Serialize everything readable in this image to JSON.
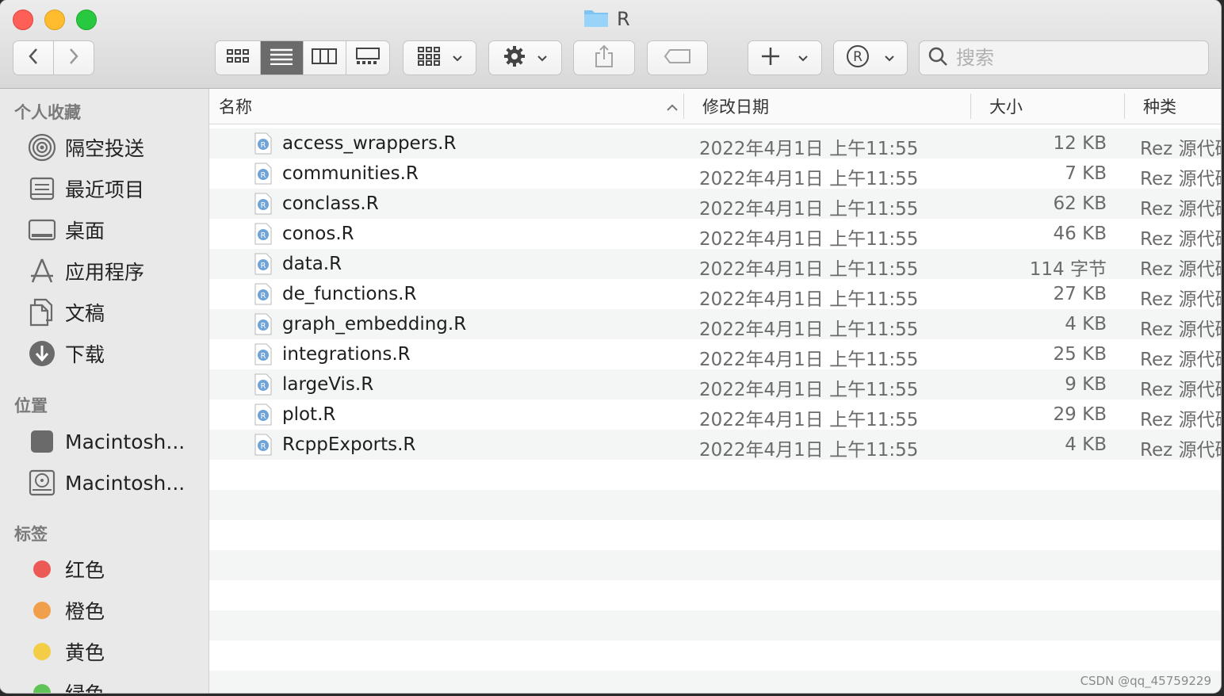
{
  "window": {
    "title": "R"
  },
  "toolbar": {
    "back_icon": "chevron-left-icon",
    "forward_icon": "chevron-right-icon",
    "view_modes": [
      "icon-view",
      "list-view",
      "column-view",
      "gallery-view"
    ],
    "active_view": "list-view",
    "search_placeholder": "搜索"
  },
  "sidebar": {
    "favorites_heading": "个人收藏",
    "favorites": [
      {
        "label": "隔空投送",
        "icon": "airdrop-icon"
      },
      {
        "label": "最近项目",
        "icon": "recents-icon"
      },
      {
        "label": "桌面",
        "icon": "desktop-icon"
      },
      {
        "label": "应用程序",
        "icon": "applications-icon"
      },
      {
        "label": "文稿",
        "icon": "documents-icon"
      },
      {
        "label": "下载",
        "icon": "downloads-icon"
      }
    ],
    "locations_heading": "位置",
    "locations": [
      {
        "label": "Macintosh...",
        "icon": "disk-icon"
      },
      {
        "label": "Macintosh...",
        "icon": "external-disk-icon"
      }
    ],
    "tags_heading": "标签",
    "tags": [
      {
        "label": "红色",
        "color": "#ec5a55"
      },
      {
        "label": "橙色",
        "color": "#f0a04b"
      },
      {
        "label": "黄色",
        "color": "#f4cd47"
      },
      {
        "label": "绿色",
        "color": "#5fc455"
      }
    ]
  },
  "columns": {
    "name": "名称",
    "date": "修改日期",
    "size": "大小",
    "kind": "种类"
  },
  "files": [
    {
      "name": "access_wrappers.R",
      "date": "2022年4月1日 上午11:55",
      "size": "12 KB",
      "kind": "Rez 源代码"
    },
    {
      "name": "communities.R",
      "date": "2022年4月1日 上午11:55",
      "size": "7 KB",
      "kind": "Rez 源代码"
    },
    {
      "name": "conclass.R",
      "date": "2022年4月1日 上午11:55",
      "size": "62 KB",
      "kind": "Rez 源代码"
    },
    {
      "name": "conos.R",
      "date": "2022年4月1日 上午11:55",
      "size": "46 KB",
      "kind": "Rez 源代码"
    },
    {
      "name": "data.R",
      "date": "2022年4月1日 上午11:55",
      "size": "114 字节",
      "kind": "Rez 源代码"
    },
    {
      "name": "de_functions.R",
      "date": "2022年4月1日 上午11:55",
      "size": "27 KB",
      "kind": "Rez 源代码"
    },
    {
      "name": "graph_embedding.R",
      "date": "2022年4月1日 上午11:55",
      "size": "4 KB",
      "kind": "Rez 源代码"
    },
    {
      "name": "integrations.R",
      "date": "2022年4月1日 上午11:55",
      "size": "25 KB",
      "kind": "Rez 源代码"
    },
    {
      "name": "largeVis.R",
      "date": "2022年4月1日 上午11:55",
      "size": "9 KB",
      "kind": "Rez 源代码"
    },
    {
      "name": "plot.R",
      "date": "2022年4月1日 上午11:55",
      "size": "29 KB",
      "kind": "Rez 源代码"
    },
    {
      "name": "RcppExports.R",
      "date": "2022年4月1日 上午11:55",
      "size": "4 KB",
      "kind": "Rez 源代码"
    }
  ],
  "watermark": "CSDN @qq_45759229"
}
